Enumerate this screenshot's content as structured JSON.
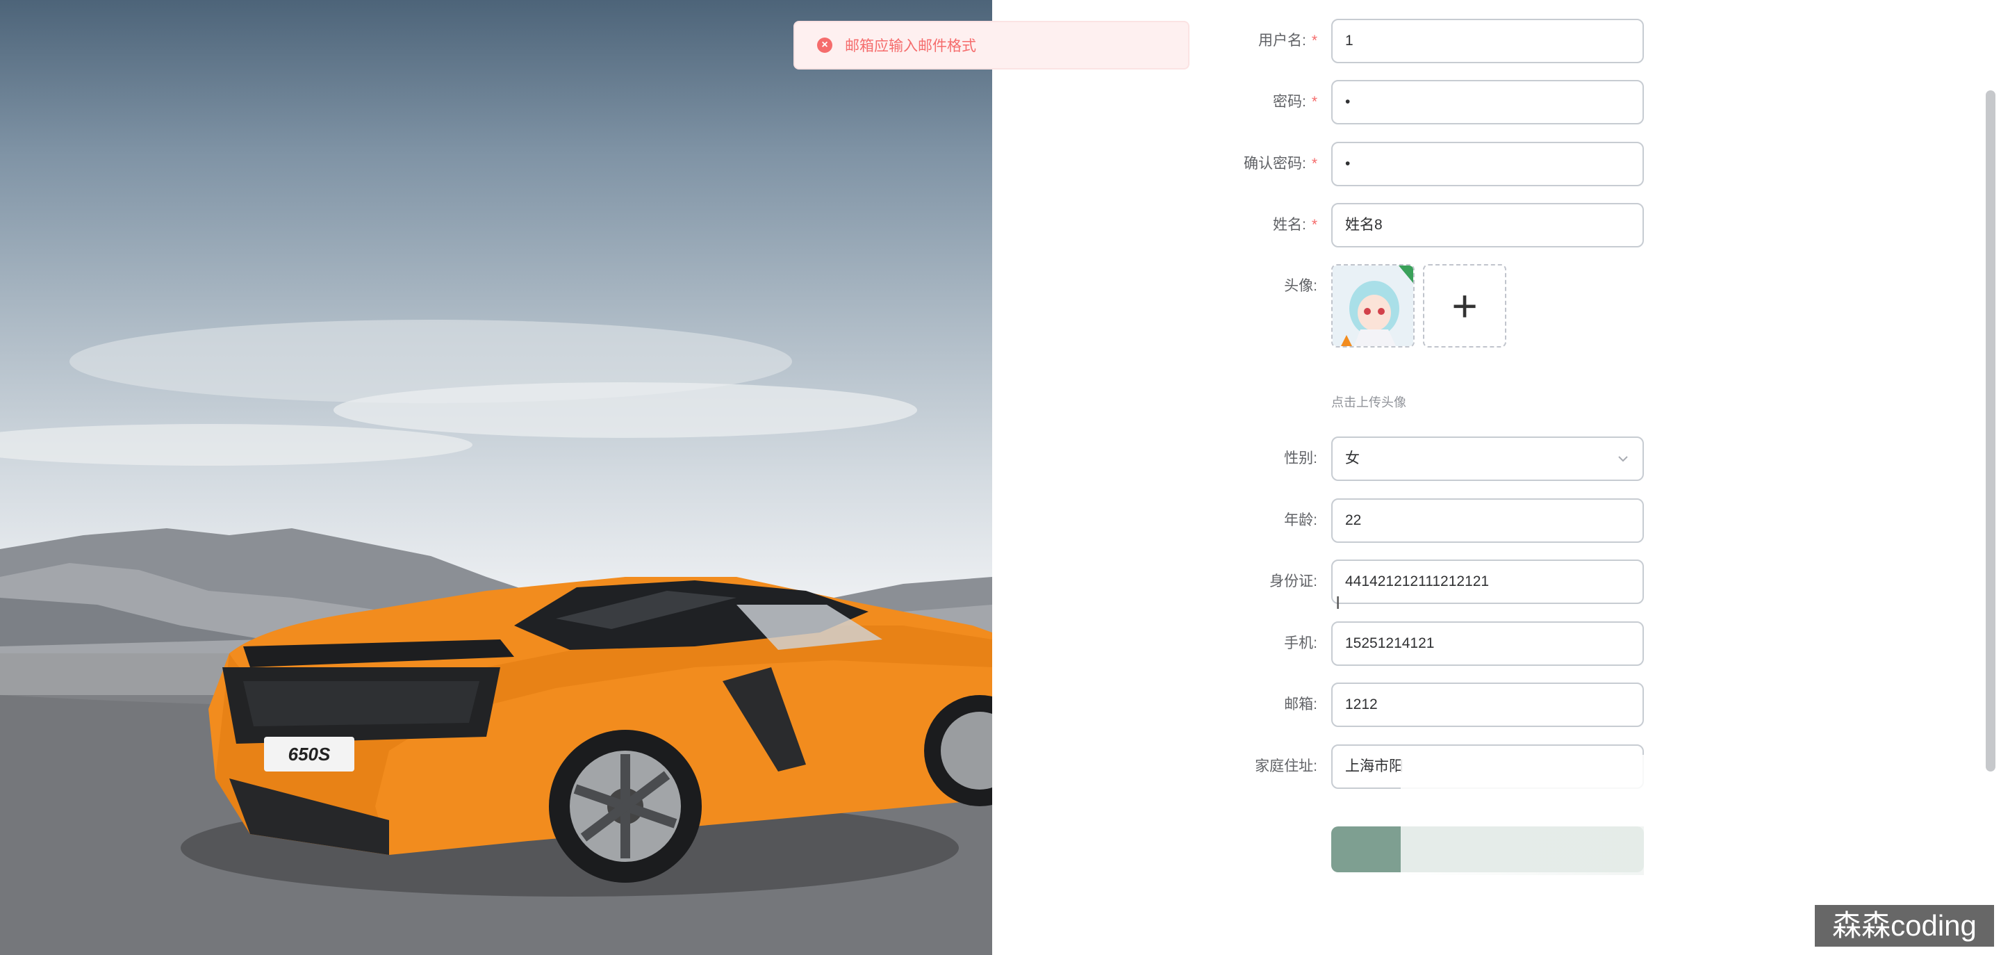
{
  "toast": {
    "message": "邮箱应输入邮件格式",
    "type": "error",
    "color": "#f56c6c"
  },
  "form": {
    "fields": [
      {
        "label": "用户名:",
        "value": "1",
        "required": true
      },
      {
        "label": "密码:",
        "value": "•",
        "required": true
      },
      {
        "label": "确认密码:",
        "value": "•",
        "required": true
      },
      {
        "label": "姓名:",
        "value": "姓名8",
        "required": true
      }
    ],
    "avatar": {
      "label": "头像:",
      "hint": "点击上传头像"
    },
    "gender": {
      "label": "性别:",
      "value": "女"
    },
    "fields2": [
      {
        "label": "年龄:",
        "value": "22"
      },
      {
        "label": "身份证:",
        "value": "441421212111212121"
      },
      {
        "label": "手机:",
        "value": "15251214121"
      },
      {
        "label": "邮箱:",
        "value": "1212"
      },
      {
        "label": "家庭住址:",
        "value": "上海市阳"
      }
    ],
    "required_mark": "*",
    "submit_color": "#7e9f91"
  },
  "hero": {
    "plate": "650S",
    "car_color": "#f28c1e"
  },
  "watermark": "森森coding"
}
